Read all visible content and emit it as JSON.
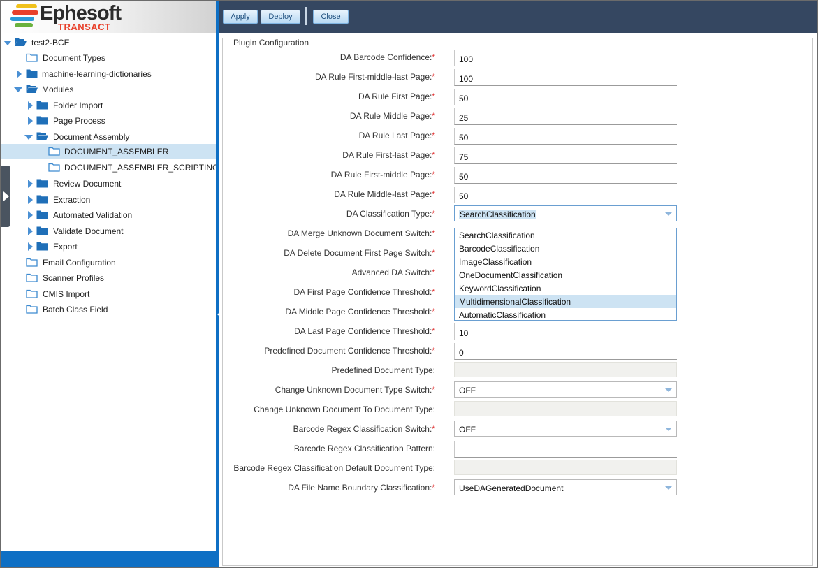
{
  "brand": {
    "name": "Ephesoft",
    "product": "TRANSACT",
    "stripe_colors": [
      "#f0c11b",
      "#e8402a",
      "#2c9ad7",
      "#6ab23e"
    ]
  },
  "toolbar": {
    "apply_label": "Apply",
    "deploy_label": "Deploy",
    "close_label": "Close"
  },
  "tree": {
    "items": [
      {
        "label": "test2-BCE",
        "icon": "folder-open-icon",
        "expand": "down"
      },
      {
        "label": "Document Types",
        "icon": "folder-outline-icon",
        "expand": ""
      },
      {
        "label": "machine-learning-dictionaries",
        "icon": "folder-icon",
        "expand": "right"
      },
      {
        "label": "Modules",
        "icon": "folder-open-icon",
        "expand": "down"
      },
      {
        "label": "Folder Import",
        "icon": "folder-icon",
        "expand": "right"
      },
      {
        "label": "Page Process",
        "icon": "folder-icon",
        "expand": "right"
      },
      {
        "label": "Document Assembly",
        "icon": "folder-open-icon",
        "expand": "down"
      },
      {
        "label": "DOCUMENT_ASSEMBLER",
        "icon": "folder-outline-icon",
        "expand": "",
        "selected": true
      },
      {
        "label": "DOCUMENT_ASSEMBLER_SCRIPTING_PLUGIN",
        "icon": "folder-outline-icon",
        "expand": ""
      },
      {
        "label": "Review Document",
        "icon": "folder-icon",
        "expand": "right"
      },
      {
        "label": "Extraction",
        "icon": "folder-icon",
        "expand": "right"
      },
      {
        "label": "Automated Validation",
        "icon": "folder-icon",
        "expand": "right"
      },
      {
        "label": "Validate Document",
        "icon": "folder-icon",
        "expand": "right"
      },
      {
        "label": "Export",
        "icon": "folder-icon",
        "expand": "right"
      },
      {
        "label": "Email Configuration",
        "icon": "folder-outline-icon",
        "expand": ""
      },
      {
        "label": "Scanner Profiles",
        "icon": "folder-outline-icon",
        "expand": ""
      },
      {
        "label": "CMIS Import",
        "icon": "folder-outline-icon",
        "expand": ""
      },
      {
        "label": "Batch Class Field",
        "icon": "folder-outline-icon",
        "expand": ""
      }
    ]
  },
  "config": {
    "legend": "Plugin Configuration",
    "required_mark": "*",
    "fields": [
      {
        "label": "DA Barcode Confidence:",
        "required": true,
        "type": "text",
        "value": "100"
      },
      {
        "label": "DA Rule First-middle-last Page:",
        "required": true,
        "type": "text",
        "value": "100"
      },
      {
        "label": "DA Rule First Page:",
        "required": true,
        "type": "text",
        "value": "50"
      },
      {
        "label": "DA Rule Middle Page:",
        "required": true,
        "type": "text",
        "value": "25"
      },
      {
        "label": "DA Rule Last Page:",
        "required": true,
        "type": "text",
        "value": "50"
      },
      {
        "label": "DA Rule First-last Page:",
        "required": true,
        "type": "text",
        "value": "75"
      },
      {
        "label": "DA Rule First-middle Page:",
        "required": true,
        "type": "text",
        "value": "50"
      },
      {
        "label": "DA Rule Middle-last Page:",
        "required": true,
        "type": "text",
        "value": "50"
      },
      {
        "label": "DA Classification Type:",
        "required": true,
        "type": "select-open",
        "value": "SearchClassification"
      },
      {
        "label": "DA Merge Unknown Document Switch:",
        "required": true,
        "type": "hidden",
        "value": ""
      },
      {
        "label": "DA Delete Document First Page Switch:",
        "required": true,
        "type": "hidden",
        "value": ""
      },
      {
        "label": "Advanced DA Switch:",
        "required": true,
        "type": "hidden",
        "value": ""
      },
      {
        "label": "DA First Page Confidence Threshold:",
        "required": true,
        "type": "hidden",
        "value": ""
      },
      {
        "label": "DA Middle Page Confidence Threshold:",
        "required": true,
        "type": "hidden",
        "value": ""
      },
      {
        "label": "DA Last Page Confidence Threshold:",
        "required": true,
        "type": "text",
        "value": "10"
      },
      {
        "label": "Predefined Document Confidence Threshold:",
        "required": true,
        "type": "text",
        "value": "0"
      },
      {
        "label": "Predefined Document Type:",
        "required": false,
        "type": "disabled",
        "value": ""
      },
      {
        "label": "Change Unknown Document Type Switch:",
        "required": true,
        "type": "select",
        "value": "OFF"
      },
      {
        "label": "Change Unknown Document To Document Type:",
        "required": false,
        "type": "disabled",
        "value": ""
      },
      {
        "label": "Barcode Regex Classification Switch:",
        "required": true,
        "type": "select",
        "value": "OFF"
      },
      {
        "label": "Barcode Regex Classification Pattern:",
        "required": false,
        "type": "text",
        "value": ""
      },
      {
        "label": "Barcode Regex Classification Default Document Type:",
        "required": false,
        "type": "disabled",
        "value": ""
      },
      {
        "label": "DA File Name Boundary Classification:",
        "required": true,
        "type": "select",
        "value": "UseDAGeneratedDocument"
      }
    ],
    "classification_options": [
      {
        "label": "SearchClassification",
        "highlighted": false
      },
      {
        "label": "BarcodeClassification",
        "highlighted": false
      },
      {
        "label": "ImageClassification",
        "highlighted": false
      },
      {
        "label": "OneDocumentClassification",
        "highlighted": false
      },
      {
        "label": "KeywordClassification",
        "highlighted": false
      },
      {
        "label": "MultidimensionalClassification",
        "highlighted": true
      },
      {
        "label": "AutomaticClassification",
        "highlighted": false
      }
    ]
  }
}
